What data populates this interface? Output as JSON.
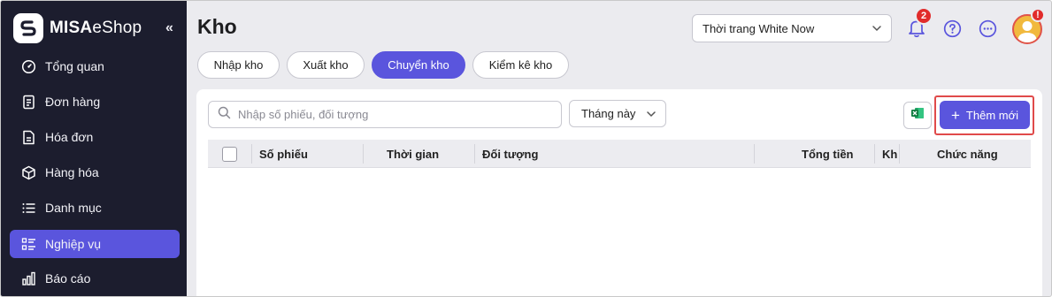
{
  "sidebar": {
    "brand_bold": "MISA",
    "brand_light": "eShop",
    "collapse_glyph": "«",
    "items": [
      {
        "label": "Tổng quan",
        "icon": "dashboard-icon"
      },
      {
        "label": "Đơn hàng",
        "icon": "order-icon"
      },
      {
        "label": "Hóa đơn",
        "icon": "invoice-icon"
      },
      {
        "label": "Hàng hóa",
        "icon": "box-icon"
      },
      {
        "label": "Danh mục",
        "icon": "list-icon"
      },
      {
        "label": "Nghiệp vụ",
        "icon": "operations-icon",
        "active": true
      },
      {
        "label": "Báo cáo",
        "icon": "report-icon"
      }
    ]
  },
  "header": {
    "title": "Kho",
    "store": "Thời trang White Now",
    "notification_count": "2",
    "avatar_badge": "!"
  },
  "tabs": [
    {
      "label": "Nhập kho"
    },
    {
      "label": "Xuất kho"
    },
    {
      "label": "Chuyển kho",
      "active": true
    },
    {
      "label": "Kiểm kê kho"
    }
  ],
  "toolbar": {
    "search_placeholder": "Nhập số phiếu, đối tượng",
    "period": "Tháng này",
    "add_label": "Thêm mới"
  },
  "table": {
    "columns": [
      "Số phiếu",
      "Thời gian",
      "Đối tượng",
      "Tổng tiền",
      "Kh",
      "Chức năng"
    ],
    "rows": []
  },
  "colors": {
    "accent": "#5a55dd",
    "sidebar_bg": "#1c1d2e",
    "alert": "#e12b2b"
  }
}
